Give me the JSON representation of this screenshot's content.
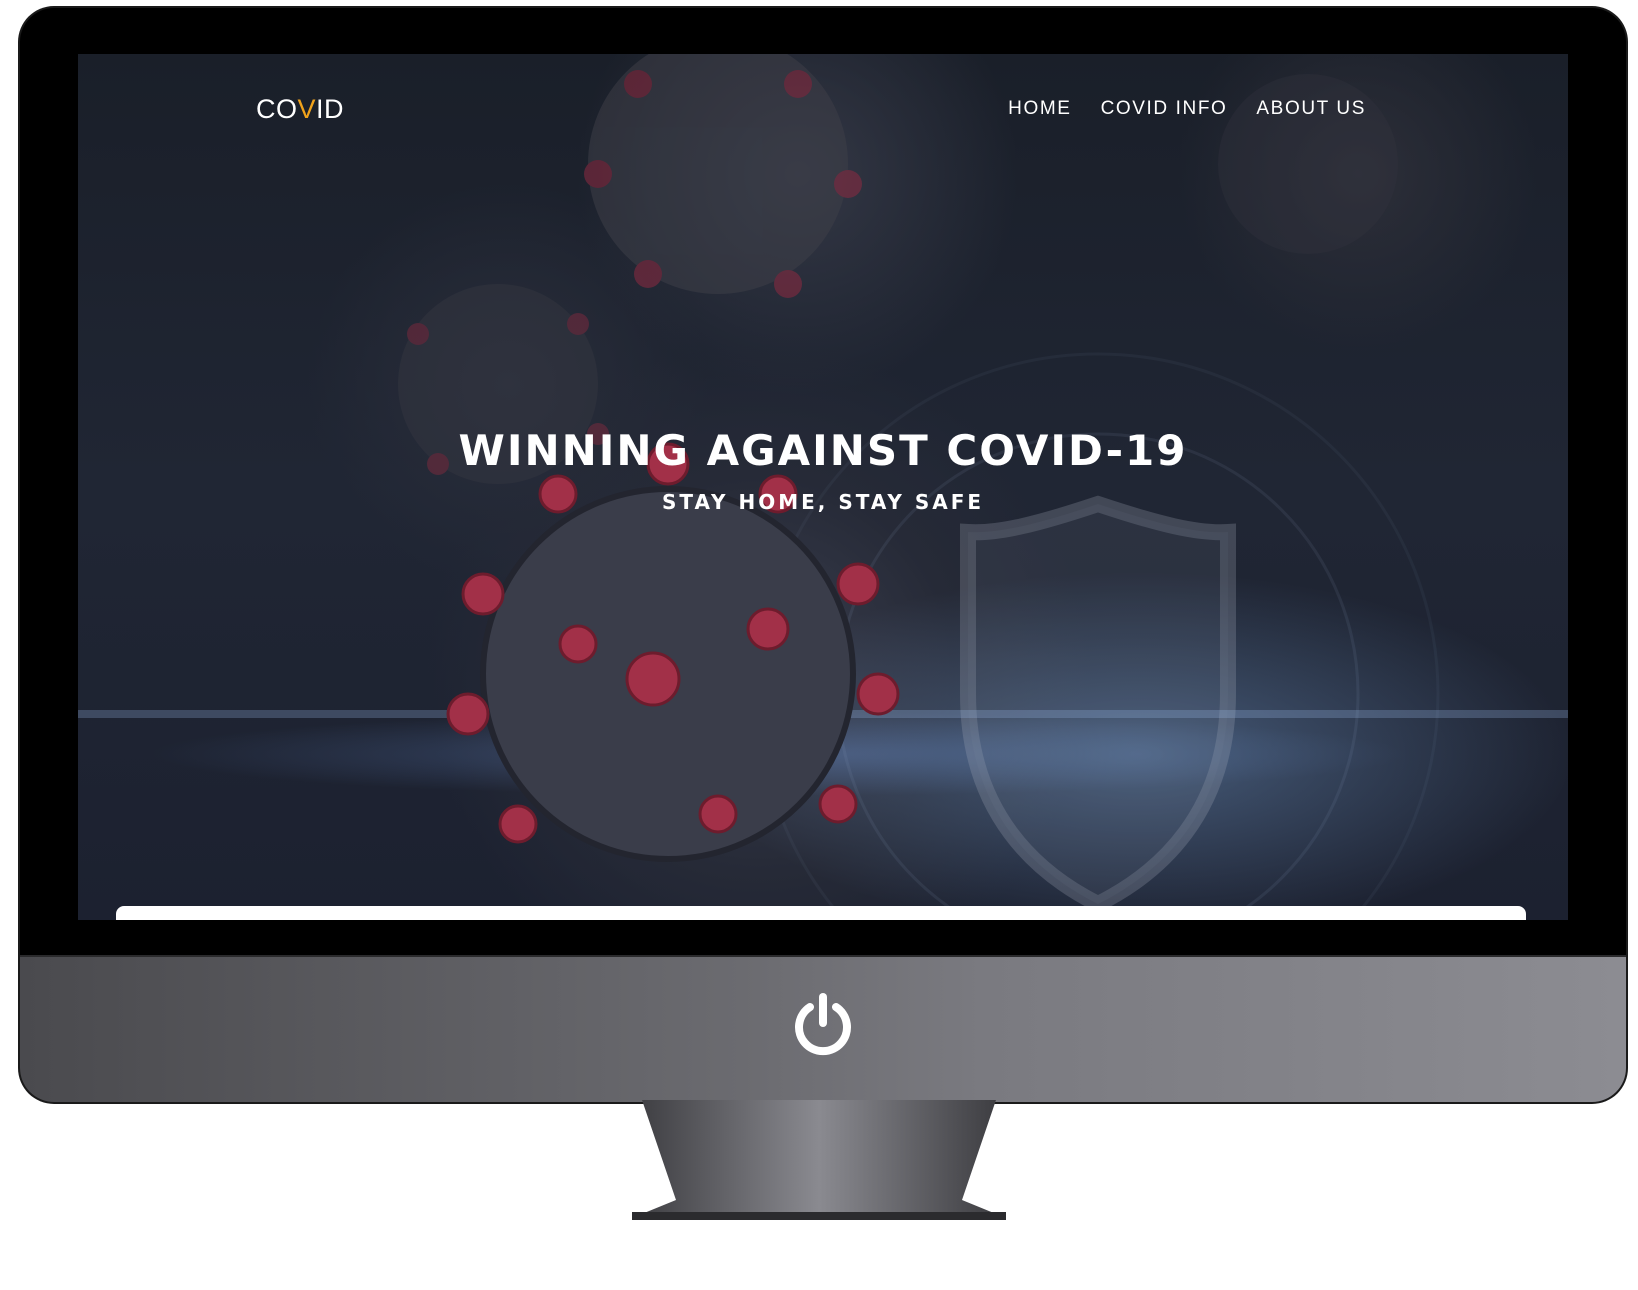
{
  "logo": {
    "prefix": "CO",
    "accent": "V",
    "suffix": "ID",
    "accent_color": "#f0a21b"
  },
  "nav": {
    "items": [
      {
        "label": "HOME"
      },
      {
        "label": "COVID INFO"
      },
      {
        "label": "ABOUT US"
      }
    ]
  },
  "hero": {
    "title": "WINNING AGAINST COVID-19",
    "subtitle": "STAY HOME, STAY SAFE"
  },
  "icons": {
    "power": "power-icon",
    "virus": "virus-icon",
    "shield": "shield-icon"
  }
}
